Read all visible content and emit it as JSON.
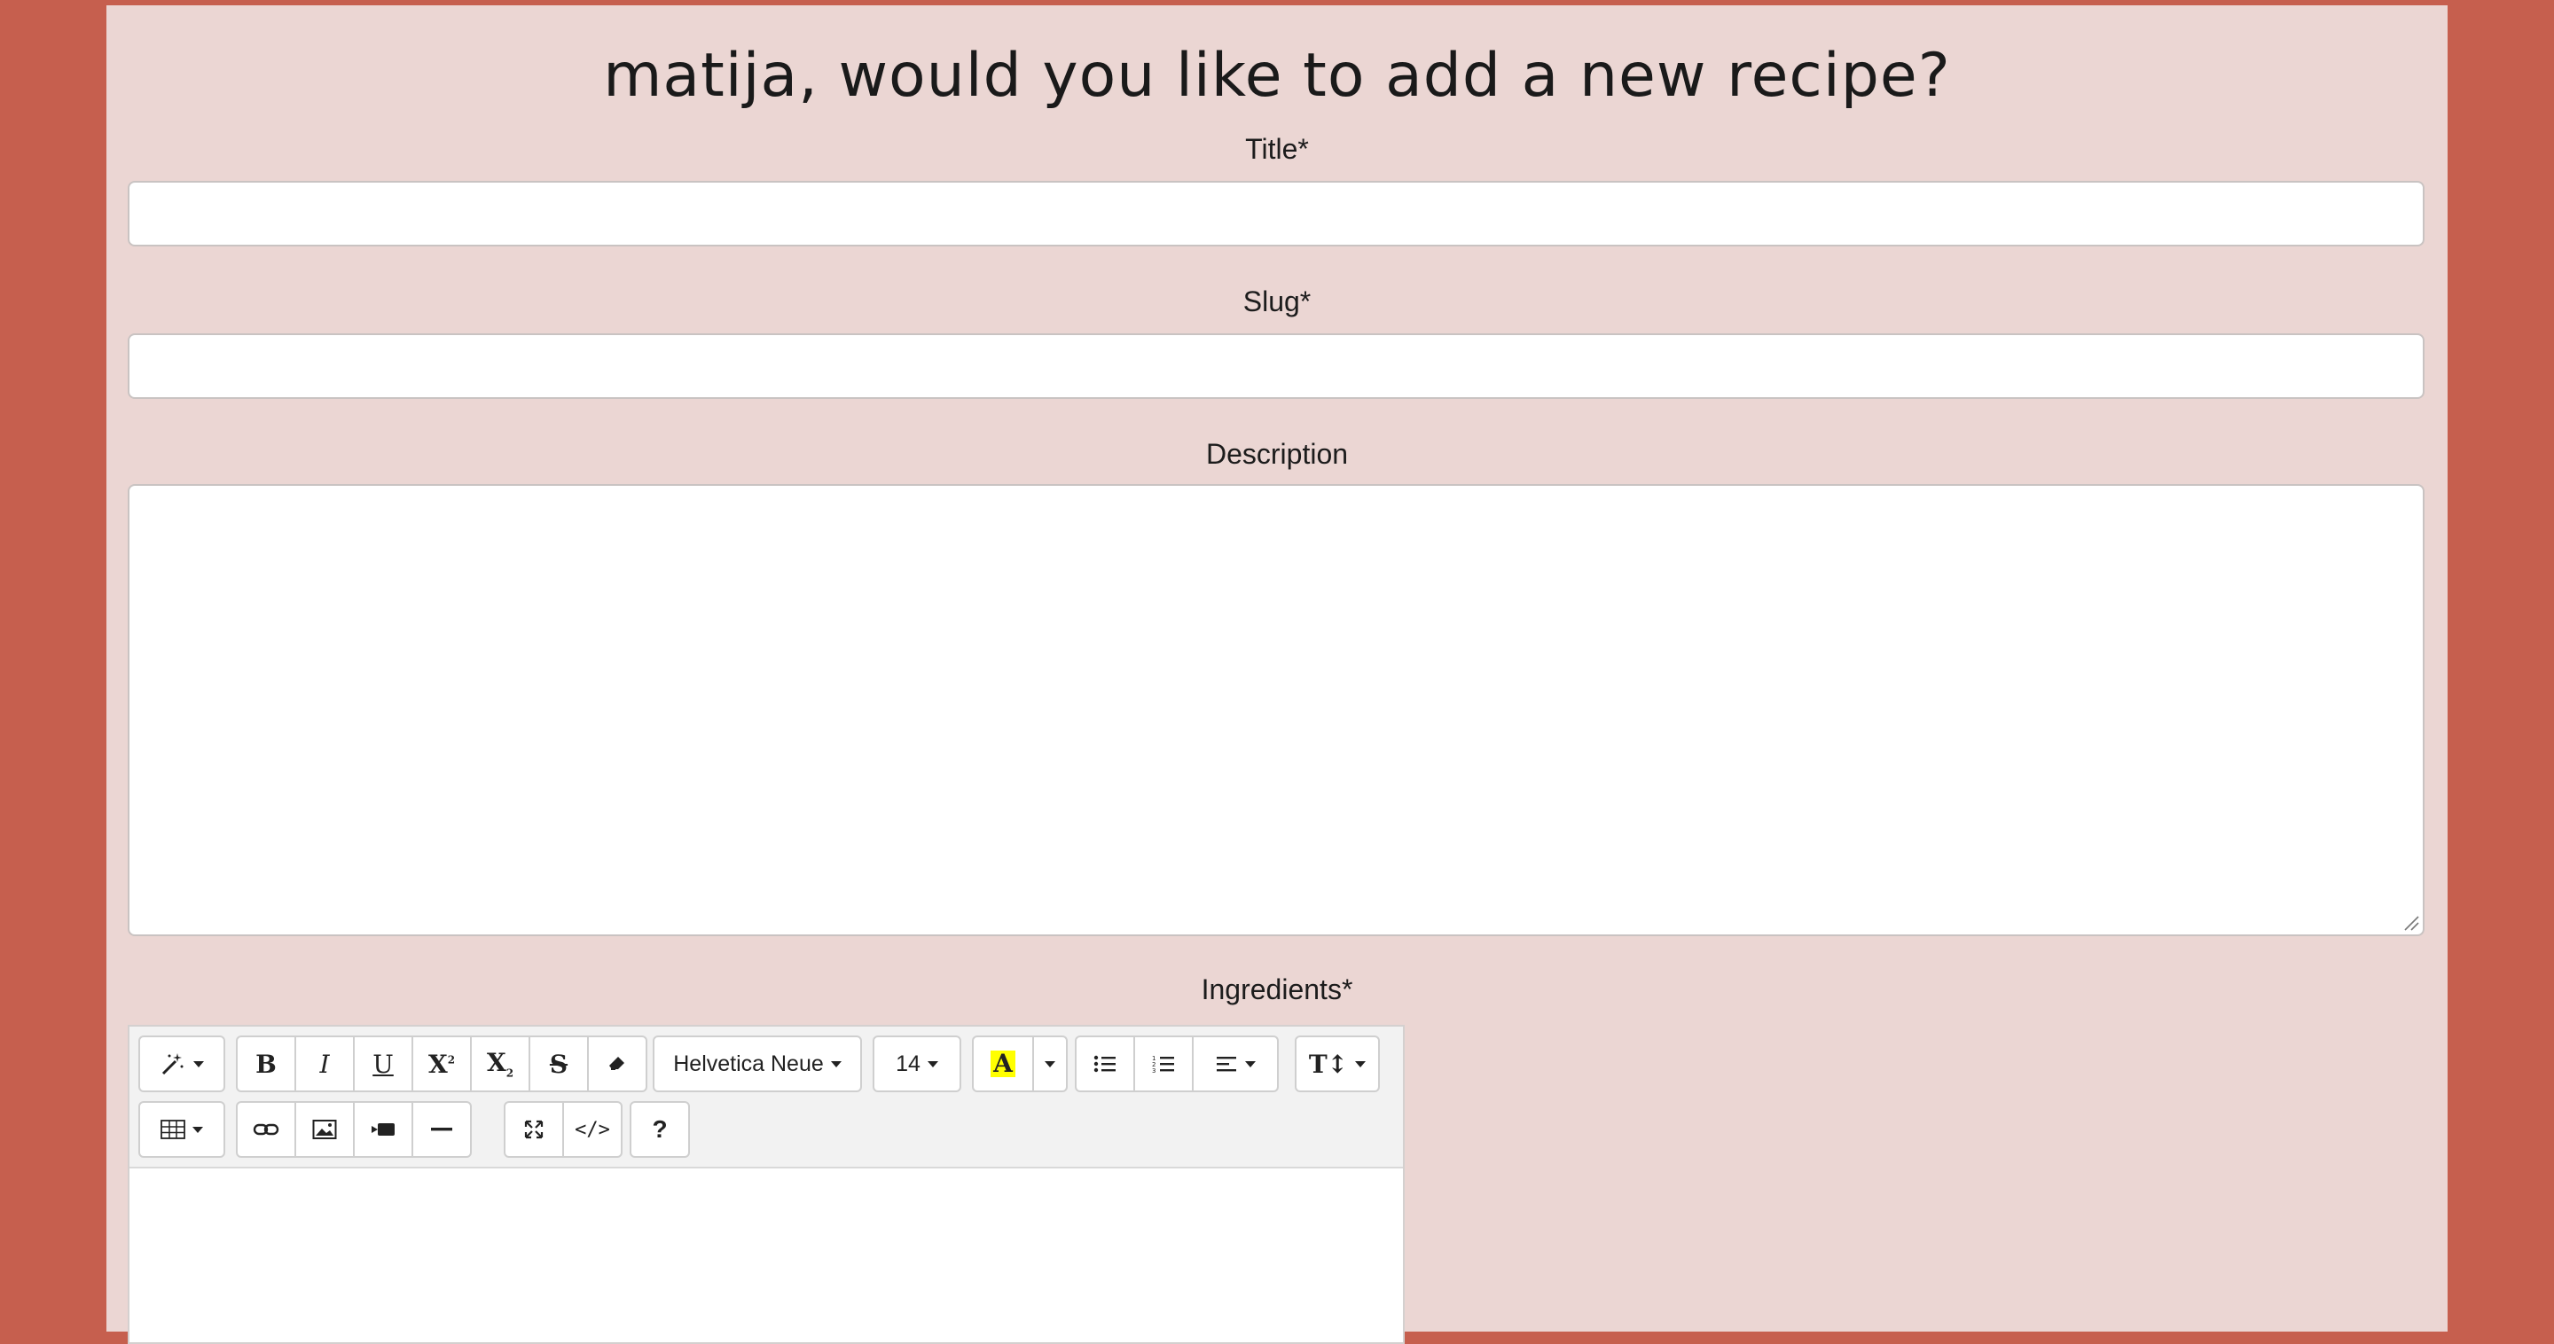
{
  "header": {
    "title": "matija, would you like to add a new recipe?"
  },
  "form": {
    "title_label": "Title*",
    "title_value": "",
    "slug_label": "Slug*",
    "slug_value": "",
    "description_label": "Description",
    "description_value": "",
    "ingredients_label": "Ingredients*"
  },
  "editor": {
    "font_family_value": "Helvetica Neue",
    "font_size_value": "14",
    "highlight_color": "#ffff00",
    "toolbar_row1": [
      "style",
      "bold",
      "italic",
      "underline",
      "superscript",
      "subscript",
      "strikethrough",
      "clear-format",
      "font-family",
      "font-size",
      "color",
      "color-dropdown",
      "unordered-list",
      "ordered-list",
      "paragraph",
      "line-height"
    ],
    "toolbar_row2": [
      "table",
      "link",
      "picture",
      "video",
      "horizontal-rule",
      "fullscreen",
      "codeview",
      "help"
    ],
    "glyphs": {
      "bold": "B",
      "italic": "I",
      "underline": "U",
      "superscript": "X",
      "subscript": "X",
      "strike": "S",
      "color_letter": "A",
      "code": "</>",
      "help": "?",
      "line_height": "T↕"
    }
  },
  "colors": {
    "background": "#c65f4e",
    "panel": "#ebd6d3"
  }
}
